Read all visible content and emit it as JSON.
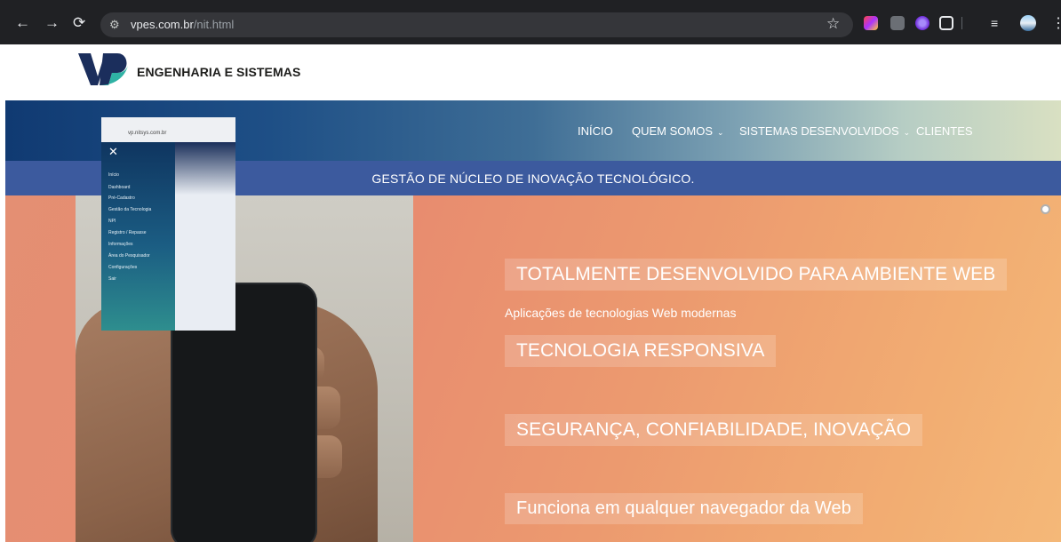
{
  "browser": {
    "url_host": "vpes.com.br",
    "url_path": "/nit.html"
  },
  "site": {
    "logo_text": "ENGENHARIA E SISTEMAS"
  },
  "nav": {
    "items": [
      {
        "label": "INÍCIO",
        "has_dropdown": false
      },
      {
        "label": "QUEM SOMOS",
        "has_dropdown": true
      },
      {
        "label": "SISTEMAS DESENVOLVIDOS",
        "has_dropdown": true
      },
      {
        "label": "CLIENTES",
        "has_dropdown": false
      }
    ]
  },
  "banner": {
    "title": "GESTÃO DE NÚCLEO DE INOVAÇÃO TECNOLÓGICO."
  },
  "hero": {
    "caption1": "TOTALMENTE DESENVOLVIDO PARA AMBIENTE WEB",
    "subtitle": "Aplicações de tecnologias Web modernas",
    "caption2": "TECNOLOGIA RESPONSIVA",
    "caption3": "SEGURANÇA, CONFIABILIDADE, INOVAÇÃO",
    "caption4": "Funciona em qualquer navegador da Web"
  },
  "phone": {
    "url": "vp.nitsys.com.br",
    "menu": [
      "Início",
      "Dashboard",
      "Pré-Cadastro",
      "Gestão da Tecnologia",
      "NPI",
      "Registro / Repasse",
      "Informações",
      "Área do Pesquisador",
      "Configurações",
      "Sair"
    ]
  },
  "colors": {
    "chrome": "#202124",
    "banner": "#3c5a9e",
    "hero_start": "#e48f73",
    "hero_end": "#f4b878"
  }
}
